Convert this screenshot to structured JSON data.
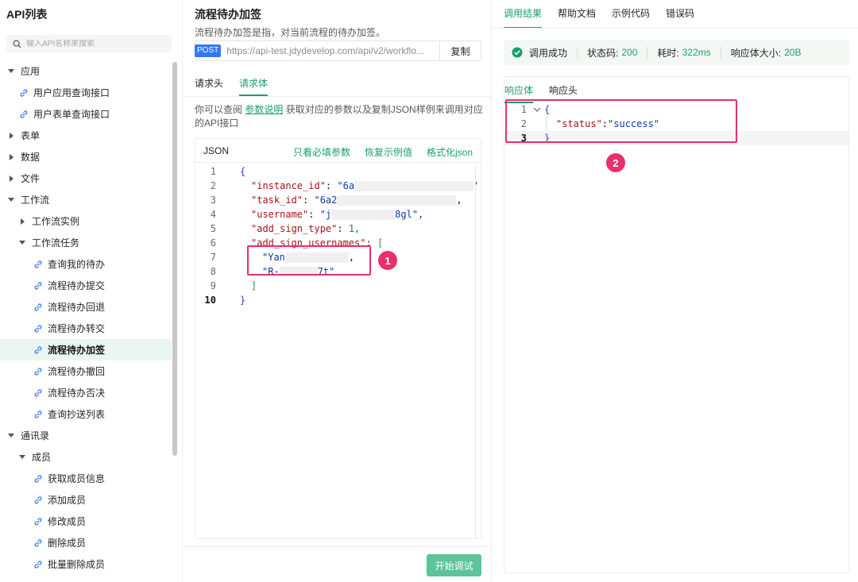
{
  "sidebar": {
    "title": "API列表",
    "search_placeholder": "输入API名称来搜索",
    "tree": [
      {
        "label": "应用",
        "kind": "folder",
        "open": true,
        "level": 0
      },
      {
        "label": "用户应用查询接口",
        "kind": "api",
        "level": 1
      },
      {
        "label": "用户表单查询接口",
        "kind": "api",
        "level": 1
      },
      {
        "label": "表单",
        "kind": "folder",
        "open": false,
        "level": 0
      },
      {
        "label": "数据",
        "kind": "folder",
        "open": false,
        "level": 0
      },
      {
        "label": "文件",
        "kind": "folder",
        "open": false,
        "level": 0
      },
      {
        "label": "工作流",
        "kind": "folder",
        "open": true,
        "level": 0
      },
      {
        "label": "工作流实例",
        "kind": "folder",
        "open": false,
        "level": 1
      },
      {
        "label": "工作流任务",
        "kind": "folder",
        "open": true,
        "level": 1
      },
      {
        "label": "查询我的待办",
        "kind": "api",
        "level": 2
      },
      {
        "label": "流程待办提交",
        "kind": "api",
        "level": 2
      },
      {
        "label": "流程待办回退",
        "kind": "api",
        "level": 2
      },
      {
        "label": "流程待办转交",
        "kind": "api",
        "level": 2
      },
      {
        "label": "流程待办加签",
        "kind": "api",
        "level": 2,
        "active": true
      },
      {
        "label": "流程待办撤回",
        "kind": "api",
        "level": 2
      },
      {
        "label": "流程待办否决",
        "kind": "api",
        "level": 2
      },
      {
        "label": "查询抄送列表",
        "kind": "api",
        "level": 2
      },
      {
        "label": "通讯录",
        "kind": "folder",
        "open": true,
        "level": 0
      },
      {
        "label": "成员",
        "kind": "folder",
        "open": true,
        "level": 1
      },
      {
        "label": "获取成员信息",
        "kind": "api",
        "level": 2
      },
      {
        "label": "添加成员",
        "kind": "api",
        "level": 2
      },
      {
        "label": "修改成员",
        "kind": "api",
        "level": 2
      },
      {
        "label": "删除成员",
        "kind": "api",
        "level": 2
      },
      {
        "label": "批量删除成员",
        "kind": "api",
        "level": 2
      }
    ]
  },
  "api": {
    "title": "流程待办加签",
    "description": "流程待办加签是指，对当前流程的待办加签。",
    "method": "POST",
    "url": "https://api-test.jdydevelop.com/api/v2/workflo...",
    "copy_label": "复制"
  },
  "request_tabs": [
    "请求头",
    "请求体"
  ],
  "hint": {
    "prefix": "你可以查阅",
    "link": "参数说明",
    "suffix": "获取对应的参数以及复制JSON样例来调用对应的API接口"
  },
  "json_editor": {
    "label": "JSON",
    "actions": [
      "只看必填参数",
      "恢复示例值",
      "格式化json"
    ],
    "lines": [
      {
        "n": "1",
        "key": "",
        "value": "{"
      },
      {
        "n": "2",
        "key": "\"instance_id\"",
        "value": "\"6a"
      },
      {
        "n": "3",
        "key": "\"task_id\"",
        "value": "\"6a2"
      },
      {
        "n": "4",
        "key": "\"username\"",
        "value": "\"j",
        "tail": "8gl\","
      },
      {
        "n": "5",
        "key": "\"add_sign_type\"",
        "value": "1,"
      },
      {
        "n": "6",
        "key": "\"add_sign_usernames\"",
        "value": "["
      },
      {
        "n": "7",
        "key": "",
        "value": "\"Yan",
        "tail": ","
      },
      {
        "n": "8",
        "key": "",
        "value": "\"R-",
        "tail": "7t\""
      },
      {
        "n": "9",
        "key": "",
        "value": "]"
      },
      {
        "n": "10",
        "key": "",
        "value": "}"
      }
    ]
  },
  "badges": {
    "one": "1",
    "two": "2"
  },
  "start_button": "开始调试",
  "result_tabs": [
    "调用结果",
    "帮助文档",
    "示例代码",
    "错误码"
  ],
  "status": {
    "text": "调用成功",
    "code_label": "状态码:",
    "code_value": "200",
    "time_label": "耗时:",
    "time_value": "322ms",
    "size_label": "响应体大小:",
    "size_value": "20B"
  },
  "response_tabs": [
    "响应体",
    "响应头"
  ],
  "response": {
    "lines": [
      {
        "n": "1",
        "text": "{"
      },
      {
        "n": "2",
        "key": "\"status\"",
        "value": "\"success\""
      },
      {
        "n": "3",
        "text": "}"
      }
    ]
  },
  "colors": {
    "accent": "#1a9f6b",
    "annotation": "#e8306a",
    "post": "#3478f6"
  }
}
